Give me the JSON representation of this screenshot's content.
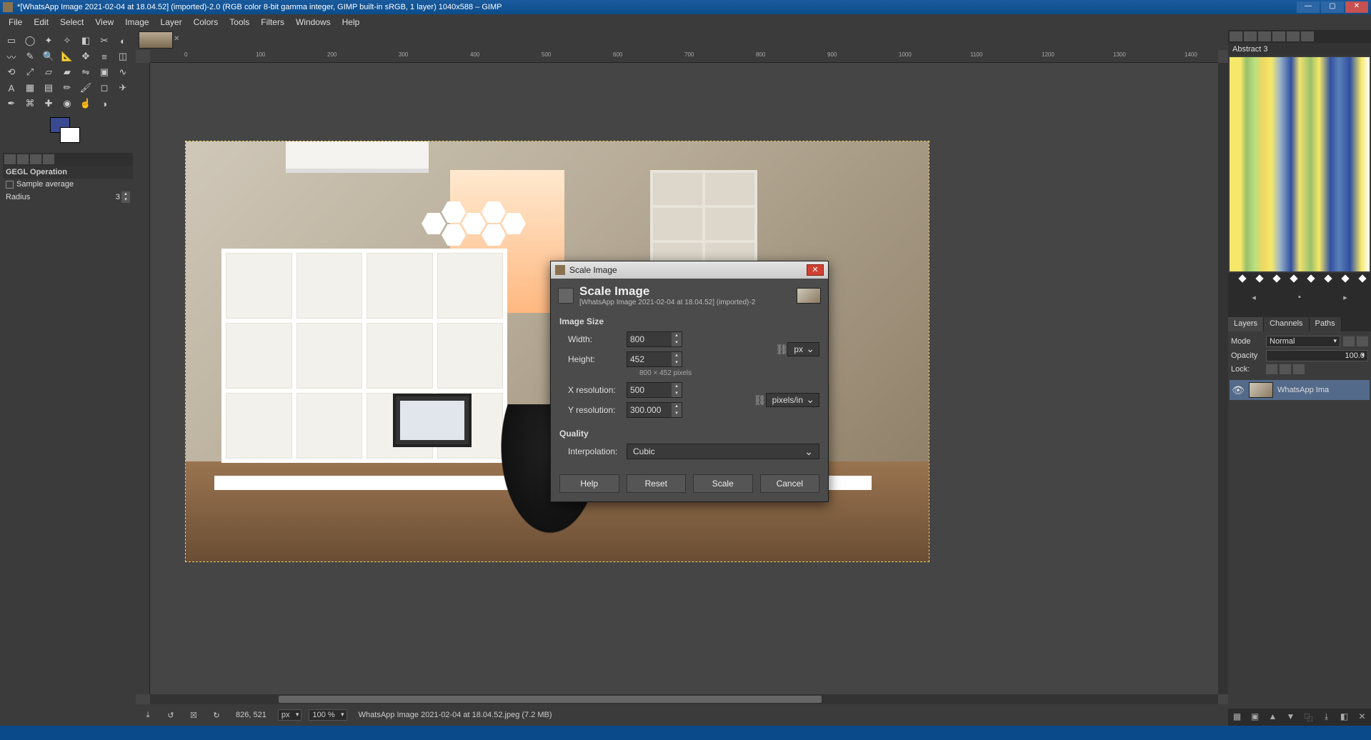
{
  "window": {
    "title": "*[WhatsApp Image 2021-02-04 at 18.04.52] (imported)-2.0 (RGB color 8-bit gamma integer, GIMP built-in sRGB, 1 layer) 1040x588 – GIMP"
  },
  "menus": [
    "File",
    "Edit",
    "Select",
    "View",
    "Image",
    "Layer",
    "Colors",
    "Tools",
    "Filters",
    "Windows",
    "Help"
  ],
  "tool_options": {
    "title": "GEGL Operation",
    "sample_average_label": "Sample average",
    "radius_label": "Radius",
    "radius_value": "3"
  },
  "gradient": {
    "name": "Abstract 3"
  },
  "panels": {
    "layers": "Layers",
    "channels": "Channels",
    "paths": "Paths",
    "mode_label": "Mode",
    "mode_value": "Normal",
    "opacity_label": "Opacity",
    "opacity_value": "100.0",
    "lock_label": "Lock:"
  },
  "layer_item": {
    "name": "WhatsApp Ima"
  },
  "status": {
    "coords": "826, 521",
    "unit": "px",
    "zoom": "100 %",
    "info": "WhatsApp Image 2021-02-04 at 18.04.52.jpeg (7.2 MB)"
  },
  "dialog": {
    "window_title": "Scale Image",
    "header_title": "Scale Image",
    "header_sub": "[WhatsApp Image 2021-02-04 at 18.04.52] (imported)-2",
    "section_image_size": "Image Size",
    "width_label": "Width:",
    "width_value": "800",
    "height_label": "Height:",
    "height_value": "452",
    "size_hint": "800 × 452 pixels",
    "size_unit": "px",
    "xres_label": "X resolution:",
    "xres_value": "500",
    "yres_label": "Y resolution:",
    "yres_value": "300.000",
    "res_unit": "pixels/in",
    "section_quality": "Quality",
    "interp_label": "Interpolation:",
    "interp_value": "Cubic",
    "btn_help": "Help",
    "btn_reset": "Reset",
    "btn_scale": "Scale",
    "btn_cancel": "Cancel"
  },
  "ruler_ticks": [
    "0",
    "100",
    "200",
    "300",
    "400",
    "500",
    "600",
    "700",
    "800",
    "900",
    "1000",
    "1100",
    "1200",
    "1300",
    "1400"
  ]
}
